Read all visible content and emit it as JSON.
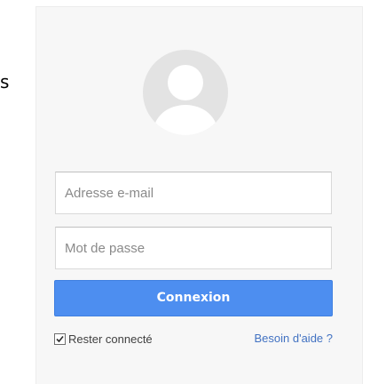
{
  "left_fragment": {
    "text": "s"
  },
  "login": {
    "avatar_icon": "user-silhouette",
    "email_placeholder": "Adresse e-mail",
    "password_placeholder": "Mot de passe",
    "submit_label": "Connexion",
    "remember_me_label": "Rester connecté",
    "remember_me_checked": true,
    "help_link_label": "Besoin d'aide ?"
  },
  "colors": {
    "accent": "#4d8ef0",
    "link": "#4272c2",
    "card_background": "#f7f7f7"
  }
}
